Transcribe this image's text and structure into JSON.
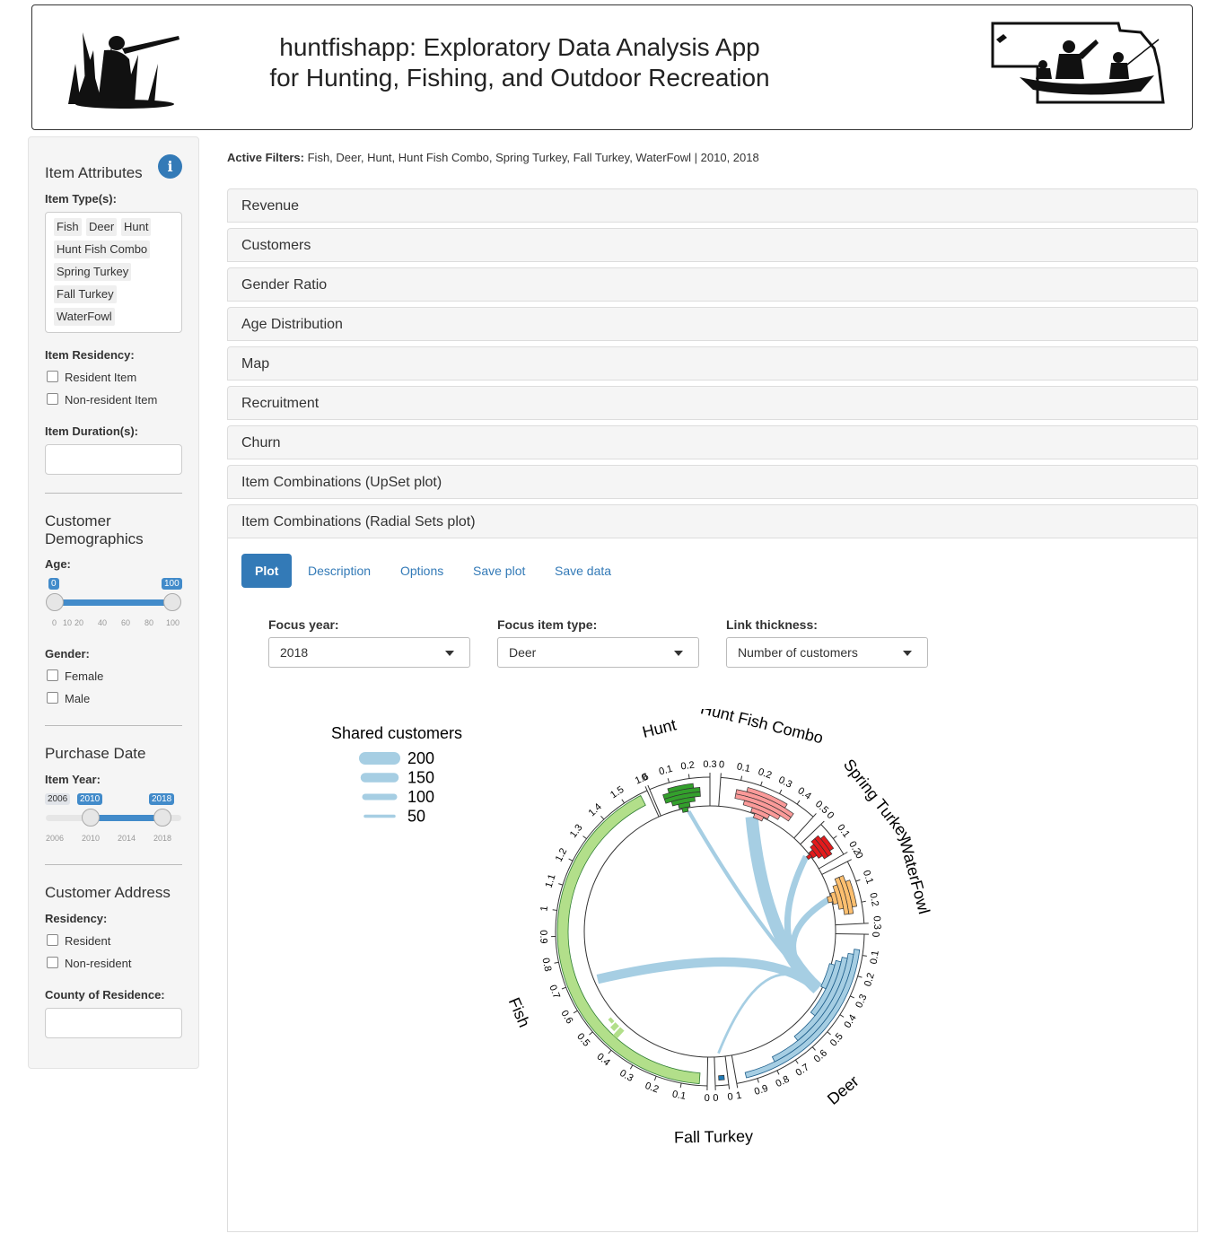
{
  "header": {
    "title_line1": "huntfishapp: Exploratory Data Analysis App",
    "title_line2": "for Hunting, Fishing, and Outdoor Recreation"
  },
  "sidebar": {
    "item_attributes_heading": "Item Attributes",
    "info_icon": "info-icon",
    "item_types_label": "Item Type(s):",
    "item_types": [
      "Fish",
      "Deer",
      "Hunt",
      "Hunt Fish Combo",
      "Spring Turkey",
      "Fall Turkey",
      "WaterFowl"
    ],
    "item_residency_label": "Item Residency:",
    "item_residency_options": [
      "Resident Item",
      "Non-resident Item"
    ],
    "item_duration_label": "Item Duration(s):",
    "customer_demographics_heading_1": "Customer",
    "customer_demographics_heading_2": "Demographics",
    "age_label": "Age:",
    "age_slider": {
      "min": 0,
      "max": 100,
      "value_from": 0,
      "value_to": 100,
      "from_label": "0",
      "to_label": "100",
      "ticks": [
        "0",
        "10",
        "20",
        "40",
        "60",
        "80",
        "100"
      ]
    },
    "gender_label": "Gender:",
    "gender_options": [
      "Female",
      "Male"
    ],
    "purchase_date_heading": "Purchase Date",
    "item_year_label": "Item Year:",
    "year_slider": {
      "min": 2006,
      "max": 2018,
      "value_from": 2010,
      "value_to": 2018,
      "min_label": "2006",
      "from_label": "2010",
      "to_label": "2018",
      "ticks": [
        "2006",
        "2010",
        "2014",
        "2018"
      ]
    },
    "customer_address_heading": "Customer Address",
    "residency_label": "Residency:",
    "residency_options": [
      "Resident",
      "Non-resident"
    ],
    "county_label": "County of Residence:"
  },
  "main": {
    "active_filters_label": "Active Filters:",
    "active_filters_value": "Fish, Deer, Hunt, Hunt Fish Combo, Spring Turkey, Fall Turkey, WaterFowl | 2010, 2018",
    "panels": [
      "Revenue",
      "Customers",
      "Gender Ratio",
      "Age Distribution",
      "Map",
      "Recruitment",
      "Churn",
      "Item Combinations (UpSet plot)",
      "Item Combinations (Radial Sets plot)"
    ],
    "tabs": [
      "Plot",
      "Description",
      "Options",
      "Save plot",
      "Save data"
    ],
    "active_tab": "Plot",
    "controls": {
      "focus_year_label": "Focus year:",
      "focus_year_value": "2018",
      "focus_item_label": "Focus item type:",
      "focus_item_value": "Deer",
      "link_thickness_label": "Link thickness:",
      "link_thickness_value": "Number of customers"
    }
  },
  "chart_data": {
    "type": "radial_sets",
    "legend_title": "Shared customers",
    "legend_values": [
      200,
      150,
      100,
      50
    ],
    "link_color": "#a6cee3",
    "sectors": [
      {
        "name": "Hunt",
        "color": "#33a02c",
        "axis_ticks": [
          "0",
          "0.1",
          "0.2",
          "0.3"
        ]
      },
      {
        "name": "Hunt Fish Combo",
        "color": "#fb9a99",
        "axis_ticks": [
          "0",
          "0.1",
          "0.2",
          "0.3",
          "0.4",
          "0.5"
        ]
      },
      {
        "name": "Spring Turkey",
        "color": "#e31a1c",
        "axis_ticks": [
          "0",
          "0.1",
          "0.2"
        ]
      },
      {
        "name": "WaterFowl",
        "color": "#fdbf6f",
        "axis_ticks": [
          "0",
          "0.1",
          "0.2",
          "0.3"
        ]
      },
      {
        "name": "Deer",
        "color": "#a6cee3",
        "axis_ticks": [
          "0",
          "0.1",
          "0.2",
          "0.3",
          "0.4",
          "0.5",
          "0.6",
          "0.7",
          "0.8",
          "0.9",
          "1"
        ]
      },
      {
        "name": "Fall Turkey",
        "color": "#1f78b4",
        "axis_ticks": [
          "0",
          "0"
        ]
      },
      {
        "name": "Fish",
        "color": "#b2df8a",
        "axis_ticks": [
          "0",
          "0.1",
          "0.2",
          "0.3",
          "0.4",
          "0.5",
          "0.6",
          "0.7",
          "0.8",
          "0.9",
          "1",
          "1.1",
          "1.2",
          "1.3",
          "1.4",
          "1.5",
          "1.6"
        ]
      }
    ],
    "links": [
      {
        "from": "Deer",
        "to": "Fish",
        "customers": 150
      },
      {
        "from": "Deer",
        "to": "Hunt",
        "customers": 60
      },
      {
        "from": "Deer",
        "to": "Hunt Fish Combo",
        "customers": 200
      },
      {
        "from": "Deer",
        "to": "Spring Turkey",
        "customers": 100
      },
      {
        "from": "Deer",
        "to": "WaterFowl",
        "customers": 100
      },
      {
        "from": "Deer",
        "to": "Fall Turkey",
        "customers": 40
      }
    ]
  }
}
